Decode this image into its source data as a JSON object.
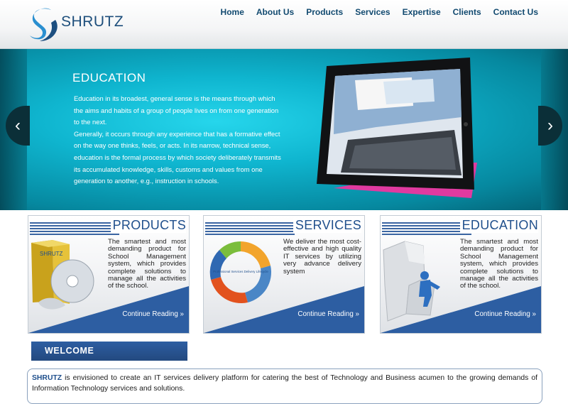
{
  "brand": {
    "name": "SHRUTZ"
  },
  "nav": [
    "Home",
    "About Us",
    "Products",
    "Services",
    "Expertise",
    "Clients",
    "Contact Us"
  ],
  "hero": {
    "title": "EDUCATION",
    "text": "Education in its broadest, general sense is the means through which the aims and habits of a group of people lives on from one generation to the next.\n Generally, it occurs through any experience that has a formative effect on the way one thinks, feels, or acts. In its narrow, technical sense, education is the formal process by which society deliberately transmits its accumulated knowledge, skills, customs and values from one generation to another, e.g., instruction in schools.",
    "prev_icon": "chevron-left-icon",
    "next_icon": "chevron-right-icon",
    "prev_glyph": "‹",
    "next_glyph": "›"
  },
  "cards": [
    {
      "title": "PRODUCTS",
      "text": "The smartest and most demanding product for School Management system, which provides complete solutions to manage all the activities of the school.",
      "link": "Continue Reading »",
      "box_label": "SHRUTZ"
    },
    {
      "title": "SERVICES",
      "text": "We deliver the most cost-effective and high quality IT services by utilizing very advance delivery system",
      "link": "Continue Reading »",
      "cycle_center": "Professional Services Delivery Lifecycle"
    },
    {
      "title": "EDUCATION",
      "text": "The smartest and most demanding product for School Management system, which provides complete solutions to manage all the activities of the school.",
      "link": "Continue Reading »"
    }
  ],
  "welcome": {
    "heading": "WELCOME",
    "brand": "SHRUTZ",
    "text": " is envisioned to create an IT services delivery platform for catering the best of Technology and Business acumen to the growing demands of Information Technology services and solutions."
  },
  "colors": {
    "accent": "#1f4f8c",
    "hero": "#0fb5cf",
    "nav": "#124a70"
  }
}
